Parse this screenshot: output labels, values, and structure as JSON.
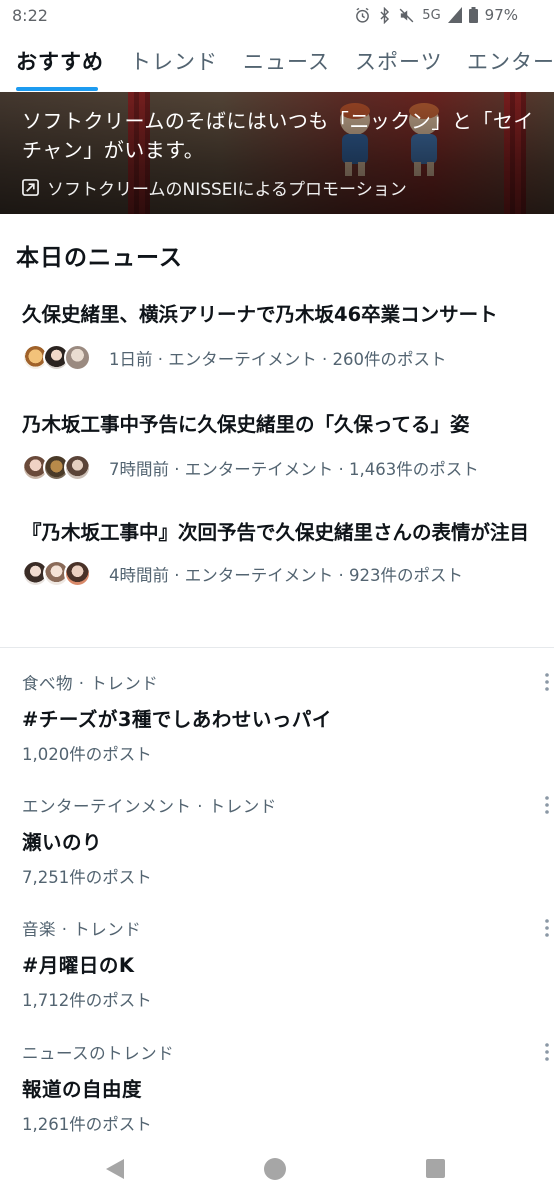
{
  "status_bar": {
    "time": "8:22",
    "network": "5G",
    "battery": "97%"
  },
  "tabs": [
    {
      "label": "おすすめ",
      "active": true
    },
    {
      "label": "トレンド",
      "active": false
    },
    {
      "label": "ニュース",
      "active": false
    },
    {
      "label": "スポーツ",
      "active": false
    },
    {
      "label": "エンターテ",
      "active": false
    }
  ],
  "promo": {
    "text": "ソフトクリームのそばにはいつも「ニックン」と「セイチャン」がいます。",
    "sponsor": "ソフトクリームのNISSEIによるプロモーション"
  },
  "today_news": {
    "title": "本日のニュース",
    "items": [
      {
        "headline": "久保史緒里、横浜アリーナで乃木坂46卒業コンサート",
        "meta": "1日前 · エンターテイメント · 260件のポスト"
      },
      {
        "headline": "乃木坂工事中予告に久保史緒里の「久保ってる」姿",
        "meta": "7時間前 · エンターテイメント · 1,463件のポスト"
      },
      {
        "headline": "『乃木坂工事中』次回予告で久保史緒里さんの表情が注目",
        "meta": "4時間前 · エンターテイメント · 923件のポスト"
      }
    ]
  },
  "trends": [
    {
      "category": "食べ物 · トレンド",
      "name": "#チーズが3種でしあわせいっパイ",
      "count": "1,020件のポスト"
    },
    {
      "category": "エンターテインメント · トレンド",
      "name": "瀬いのり",
      "count": "7,251件のポスト"
    },
    {
      "category": "音楽 · トレンド",
      "name": "#月曜日のK",
      "count": "1,712件のポスト"
    },
    {
      "category": "ニュースのトレンド",
      "name": "報道の自由度",
      "count": "1,261件のポスト"
    }
  ],
  "colors": {
    "accent": "#1d9bf0",
    "secondary_text": "#536471",
    "primary_text": "#0f1419"
  },
  "icons": [
    "alarm-icon",
    "bluetooth-icon",
    "mute-icon",
    "signal-icon",
    "battery-icon",
    "promoted-icon",
    "more-icon",
    "back-icon",
    "home-icon",
    "recents-icon"
  ]
}
